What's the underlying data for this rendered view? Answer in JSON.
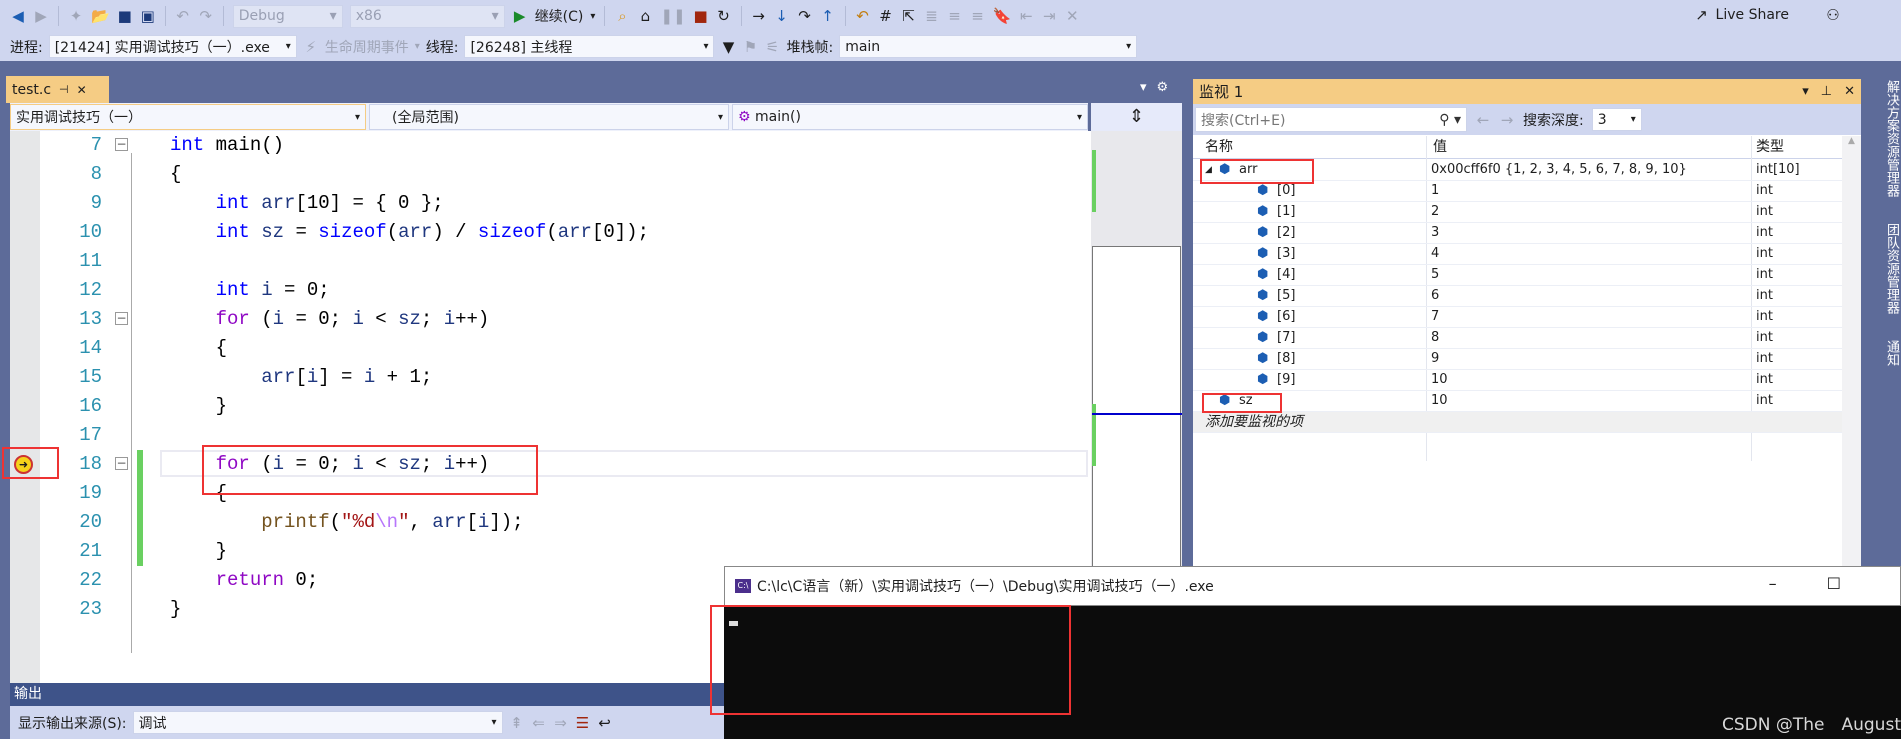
{
  "toolbar": {
    "config": "Debug",
    "platform": "x86",
    "continue": "继续(C)",
    "live_share": "Live Share",
    "process_label": "进程:",
    "process": "[21424] 实用调试技巧（一）.exe",
    "lifecycle": "生命周期事件",
    "thread_label": "线程:",
    "thread": "[26248] 主线程",
    "stack_label": "堆栈帧:",
    "stack": "main"
  },
  "editor": {
    "tab": "test.c",
    "nav": {
      "project": "实用调试技巧（一）",
      "scope": "(全局范围)",
      "function": "main()"
    },
    "current_line": 18,
    "lines": [
      {
        "n": "7",
        "fold": "-",
        "tokens": [
          [
            "int",
            "kw"
          ],
          [
            " main()",
            "pl"
          ]
        ]
      },
      {
        "n": "8",
        "tokens": [
          [
            "{",
            "pl"
          ]
        ]
      },
      {
        "n": "9",
        "tokens": [
          [
            "    ",
            "pl"
          ],
          [
            "int",
            "kw"
          ],
          [
            " arr",
            "var"
          ],
          [
            "[10] = { 0 };",
            "pl"
          ]
        ]
      },
      {
        "n": "10",
        "tokens": [
          [
            "    ",
            "pl"
          ],
          [
            "int",
            "kw"
          ],
          [
            " sz",
            "var"
          ],
          [
            " = ",
            "pl"
          ],
          [
            "sizeof",
            "kw"
          ],
          [
            "(",
            "pl"
          ],
          [
            "arr",
            "var"
          ],
          [
            ") / ",
            "pl"
          ],
          [
            "sizeof",
            "kw"
          ],
          [
            "(",
            "pl"
          ],
          [
            "arr",
            "var"
          ],
          [
            "[0]);",
            "pl"
          ]
        ]
      },
      {
        "n": "11",
        "tokens": []
      },
      {
        "n": "12",
        "tokens": [
          [
            "    ",
            "pl"
          ],
          [
            "int",
            "kw"
          ],
          [
            " i",
            "var"
          ],
          [
            " = 0;",
            "pl"
          ]
        ]
      },
      {
        "n": "13",
        "fold": "-",
        "tokens": [
          [
            "    ",
            "pl"
          ],
          [
            "for",
            "ctl"
          ],
          [
            " (",
            "pl"
          ],
          [
            "i",
            "var"
          ],
          [
            " = 0; ",
            "pl"
          ],
          [
            "i",
            "var"
          ],
          [
            " < ",
            "pl"
          ],
          [
            "sz",
            "var"
          ],
          [
            "; ",
            "pl"
          ],
          [
            "i",
            "var"
          ],
          [
            "++)",
            "pl"
          ]
        ]
      },
      {
        "n": "14",
        "tokens": [
          [
            "    {",
            "pl"
          ]
        ]
      },
      {
        "n": "15",
        "tokens": [
          [
            "        ",
            "pl"
          ],
          [
            "arr",
            "var"
          ],
          [
            "[",
            "pl"
          ],
          [
            "i",
            "var"
          ],
          [
            "] = ",
            "pl"
          ],
          [
            "i",
            "var"
          ],
          [
            " + 1;",
            "pl"
          ]
        ]
      },
      {
        "n": "16",
        "tokens": [
          [
            "    }",
            "pl"
          ]
        ]
      },
      {
        "n": "17",
        "tokens": []
      },
      {
        "n": "18",
        "fold": "-",
        "tokens": [
          [
            "    ",
            "pl"
          ],
          [
            "for",
            "ctl"
          ],
          [
            " (",
            "pl"
          ],
          [
            "i",
            "var"
          ],
          [
            " = 0; ",
            "pl"
          ],
          [
            "i",
            "var"
          ],
          [
            " < ",
            "pl"
          ],
          [
            "sz",
            "var"
          ],
          [
            "; ",
            "pl"
          ],
          [
            "i",
            "var"
          ],
          [
            "++)",
            "pl"
          ]
        ]
      },
      {
        "n": "19",
        "tokens": [
          [
            "    {",
            "pl"
          ]
        ]
      },
      {
        "n": "20",
        "tokens": [
          [
            "        ",
            "pl"
          ],
          [
            "printf",
            "fn"
          ],
          [
            "(",
            "pl"
          ],
          [
            "\"%d",
            "str"
          ],
          [
            "\\n",
            "esc"
          ],
          [
            "\"",
            "str"
          ],
          [
            ", ",
            "pl"
          ],
          [
            "arr",
            "var"
          ],
          [
            "[",
            "pl"
          ],
          [
            "i",
            "var"
          ],
          [
            "]);",
            "pl"
          ]
        ]
      },
      {
        "n": "21",
        "tokens": [
          [
            "    }",
            "pl"
          ]
        ]
      },
      {
        "n": "22",
        "tokens": [
          [
            "    ",
            "pl"
          ],
          [
            "return",
            "ctl"
          ],
          [
            " 0;",
            "pl"
          ]
        ]
      },
      {
        "n": "23",
        "tokens": [
          [
            "}",
            "pl"
          ]
        ]
      }
    ]
  },
  "watch": {
    "title": "监视 1",
    "search_placeholder": "搜索(Ctrl+E)",
    "depth_label": "搜索深度:",
    "depth": "3",
    "columns": [
      "名称",
      "值",
      "类型"
    ],
    "rows": [
      {
        "name": "arr",
        "value": "0x00cff6f0 {1, 2, 3, 4, 5, 6, 7, 8, 9, 10}",
        "type": "int[10]",
        "level": 0,
        "expanded": true
      },
      {
        "name": "[0]",
        "value": "1",
        "type": "int",
        "level": 1
      },
      {
        "name": "[1]",
        "value": "2",
        "type": "int",
        "level": 1
      },
      {
        "name": "[2]",
        "value": "3",
        "type": "int",
        "level": 1
      },
      {
        "name": "[3]",
        "value": "4",
        "type": "int",
        "level": 1
      },
      {
        "name": "[4]",
        "value": "5",
        "type": "int",
        "level": 1
      },
      {
        "name": "[5]",
        "value": "6",
        "type": "int",
        "level": 1
      },
      {
        "name": "[6]",
        "value": "7",
        "type": "int",
        "level": 1
      },
      {
        "name": "[7]",
        "value": "8",
        "type": "int",
        "level": 1
      },
      {
        "name": "[8]",
        "value": "9",
        "type": "int",
        "level": 1
      },
      {
        "name": "[9]",
        "value": "10",
        "type": "int",
        "level": 1
      },
      {
        "name": "sz",
        "value": "10",
        "type": "int",
        "level": 0
      }
    ],
    "add_item": "添加要监视的项"
  },
  "side_tabs": [
    "解决方案资源管理器",
    "团队资源管理器",
    "通知"
  ],
  "console": {
    "title": "C:\\lc\\C语言（新）\\实用调试技巧（一）\\Debug\\实用调试技巧（一）.exe"
  },
  "output": {
    "title": "输出",
    "source_label": "显示输出来源(S):",
    "source": "调试"
  },
  "watermark": "CSDN @The　August",
  "colors": {
    "accent_tab": "#f5cc84",
    "chrome": "#cfd6ef",
    "highlight": "#ee3333"
  }
}
